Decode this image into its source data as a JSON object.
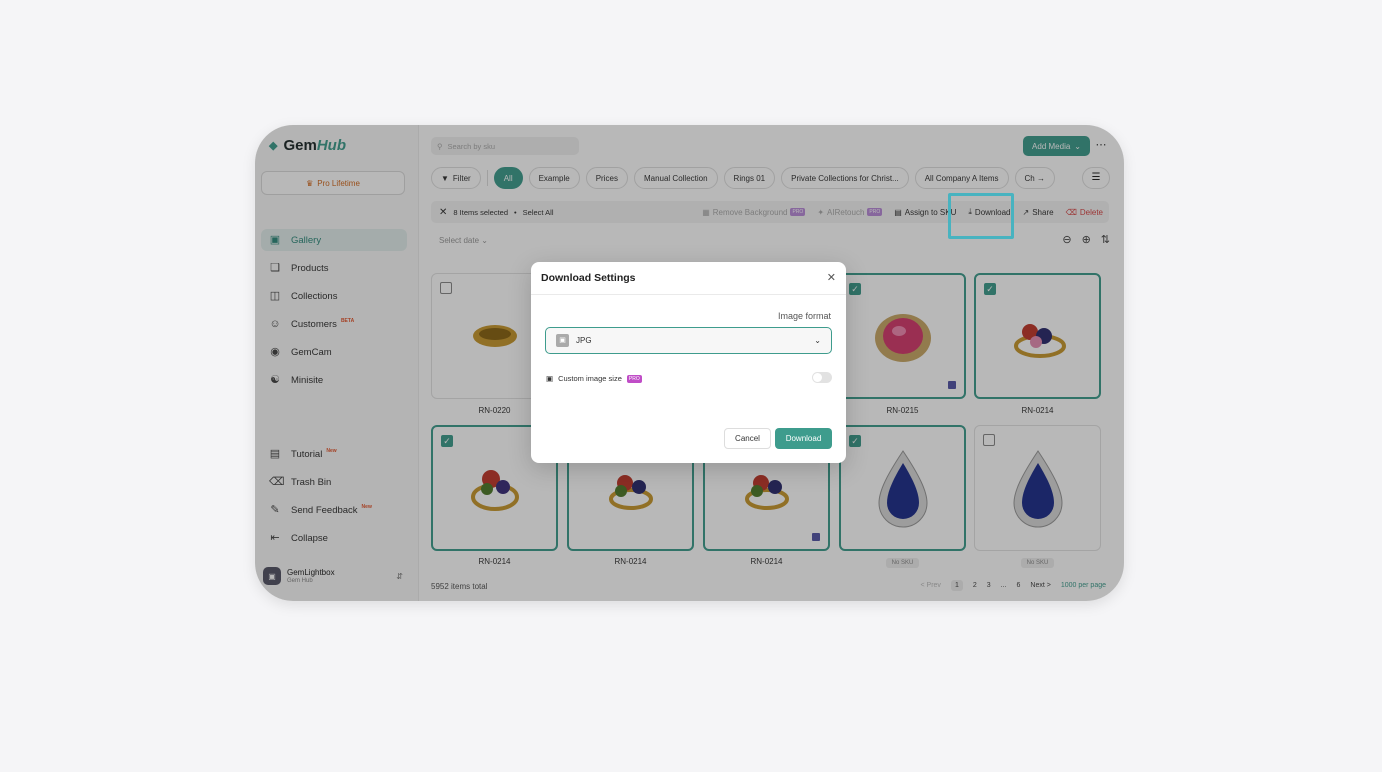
{
  "sidebar": {
    "brand_a": "Gem",
    "brand_b": "Hub",
    "pro": "Pro Lifetime",
    "nav": [
      {
        "label": "Gallery",
        "icon": "image-icon"
      },
      {
        "label": "Products",
        "icon": "box-icon"
      },
      {
        "label": "Collections",
        "icon": "book-icon"
      },
      {
        "label": "Customers",
        "icon": "users-icon",
        "tag": "BETA"
      },
      {
        "label": "GemCam",
        "icon": "camera-icon"
      },
      {
        "label": "Minisite",
        "icon": "globe-icon"
      }
    ],
    "bottom_nav": [
      {
        "label": "Tutorial",
        "icon": "presentation-icon",
        "tag": "New"
      },
      {
        "label": "Trash Bin",
        "icon": "trash-icon"
      },
      {
        "label": "Send Feedback",
        "icon": "feedback-icon",
        "tag": "New"
      },
      {
        "label": "Collapse",
        "icon": "collapse-icon"
      }
    ],
    "account": {
      "name": "GemLightbox",
      "sub": "Gem Hub"
    }
  },
  "topbar": {
    "search_placeholder": "Search by sku",
    "add_media": "Add Media"
  },
  "chips": [
    "All",
    "Example",
    "Prices",
    "Manual Collection",
    "Rings 01",
    "Private Collections for Christ...",
    "All Company A Items",
    "Ch"
  ],
  "filter_label": "Filter",
  "actionbar": {
    "selected": "8 Items selected",
    "select_all": "Select All",
    "remove_bg": "Remove Background",
    "airetouch": "AIRetouch",
    "assign": "Assign to SKU",
    "download": "Download",
    "share": "Share",
    "delete": "Delete"
  },
  "select_date": "Select date",
  "items": [
    {
      "caption": "RN-0220",
      "selected": false,
      "jewel": "gold-band"
    },
    {
      "caption": "",
      "selected": false,
      "jewel": "none"
    },
    {
      "caption": "",
      "selected": false,
      "jewel": "none"
    },
    {
      "caption": "RN-0215",
      "selected": true,
      "jewel": "pink-ring"
    },
    {
      "caption": "RN-0214",
      "selected": true,
      "jewel": "cluster-ring"
    },
    {
      "caption": "RN-0214",
      "selected": true,
      "jewel": "cluster-ring"
    },
    {
      "caption": "RN-0214",
      "selected": true,
      "jewel": "cluster-ring"
    },
    {
      "caption": "RN-0214",
      "selected": true,
      "jewel": "cluster-ring"
    },
    {
      "caption": "No SKU",
      "selected": true,
      "jewel": "blue-pear"
    },
    {
      "caption": "No SKU",
      "selected": false,
      "jewel": "blue-pear"
    }
  ],
  "footer": {
    "total": "5952 items total",
    "prev": "< Prev",
    "pages": [
      "1",
      "2",
      "3",
      "...",
      "6"
    ],
    "next": "Next >",
    "per_page": "1000 per page"
  },
  "modal": {
    "title": "Download Settings",
    "format_label": "Image format",
    "format_value": "JPG",
    "custom_size": "Custom image size",
    "pro_badge": "PRO",
    "custom_enabled": false,
    "cancel": "Cancel",
    "download": "Download"
  },
  "colors": {
    "accent": "#3e9c8d",
    "highlight": "#48b3c0",
    "danger": "#d64545"
  }
}
